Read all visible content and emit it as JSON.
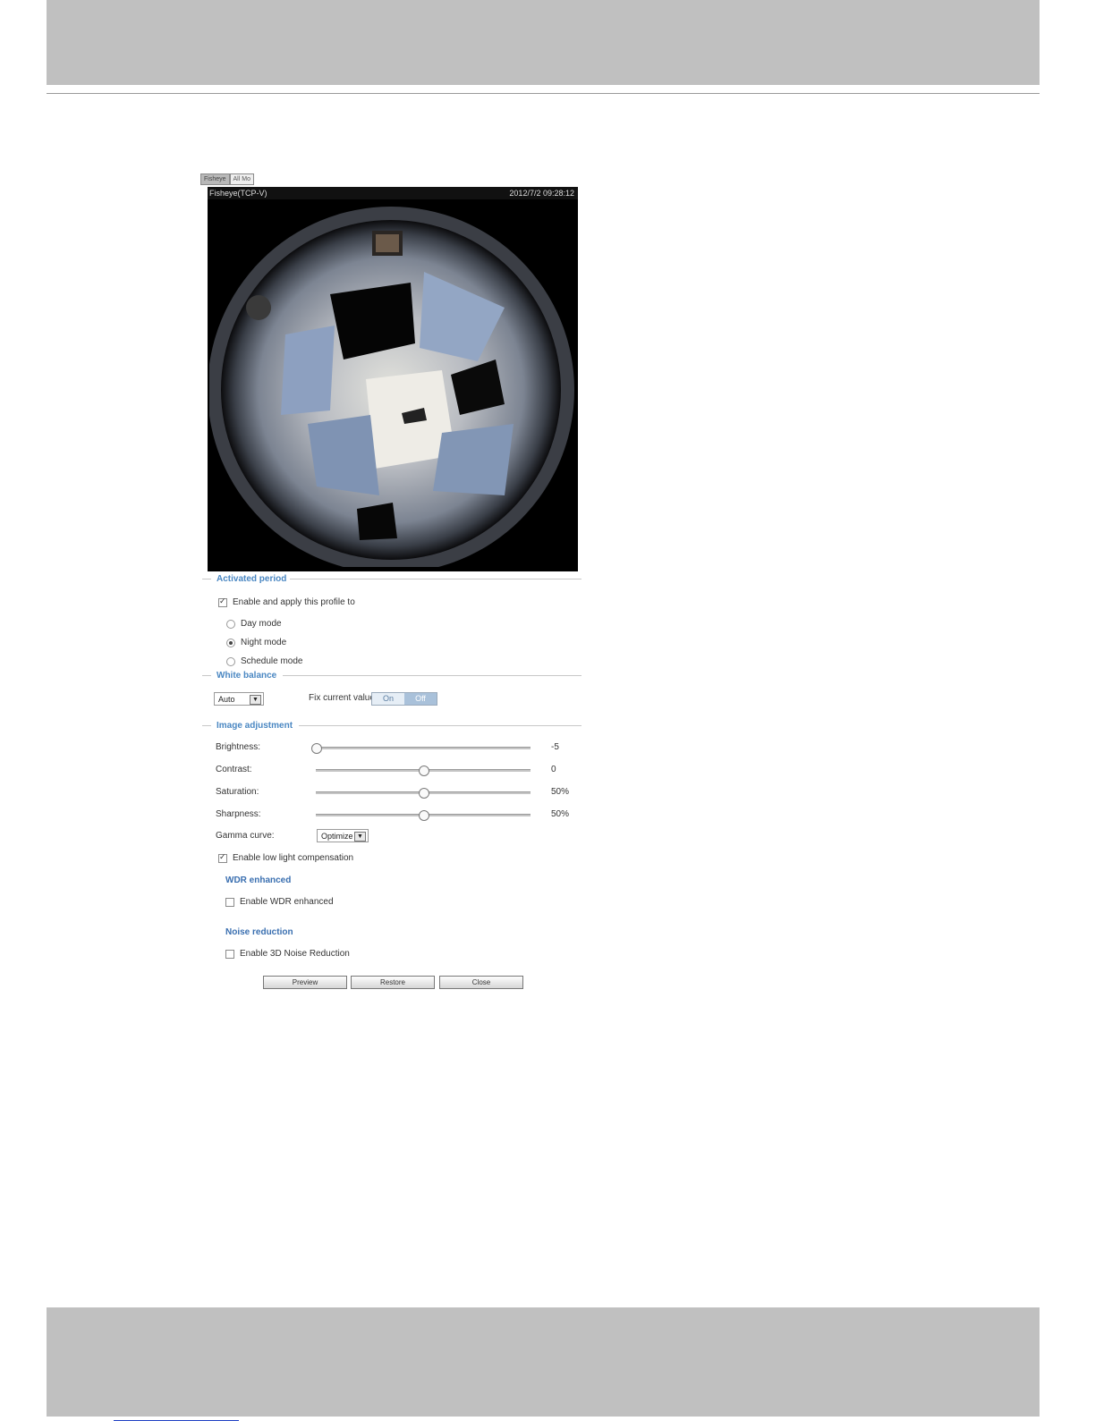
{
  "view_tabs": [
    "Fisheye",
    "All Mo"
  ],
  "video": {
    "title": "Fisheye(TCP-V)",
    "timestamp": "2012/7/2 09:28:12"
  },
  "activated_period": {
    "legend": "Activated period",
    "enable_label": "Enable and apply this profile to",
    "enable_checked": true,
    "modes": [
      {
        "label": "Day mode",
        "selected": false
      },
      {
        "label": "Night mode",
        "selected": true
      },
      {
        "label": "Schedule mode",
        "selected": false
      }
    ]
  },
  "white_balance": {
    "legend": "White balance",
    "mode_value": "Auto",
    "fix_label": "Fix current value:",
    "on_label": "On",
    "off_label": "Off",
    "selected": "Off"
  },
  "image_adjustment": {
    "legend": "Image adjustment",
    "sliders": [
      {
        "label": "Brightness:",
        "value_text": "-5",
        "level": 0.0
      },
      {
        "label": "Contrast:",
        "value_text": "0",
        "level": 0.5
      },
      {
        "label": "Saturation:",
        "value_text": "50%",
        "level": 0.5
      },
      {
        "label": "Sharpness:",
        "value_text": "50%",
        "level": 0.5
      }
    ],
    "gamma_label": "Gamma curve:",
    "gamma_value": "Optimize",
    "low_light_label": "Enable low light compensation",
    "low_light_checked": true
  },
  "wdr": {
    "title": "WDR enhanced",
    "checkbox_label": "Enable WDR enhanced",
    "checked": false
  },
  "noise": {
    "title": "Noise reduction",
    "checkbox_label": "Enable 3D Noise Reduction",
    "checked": false
  },
  "buttons": {
    "preview": "Preview",
    "restore": "Restore",
    "close": "Close"
  }
}
